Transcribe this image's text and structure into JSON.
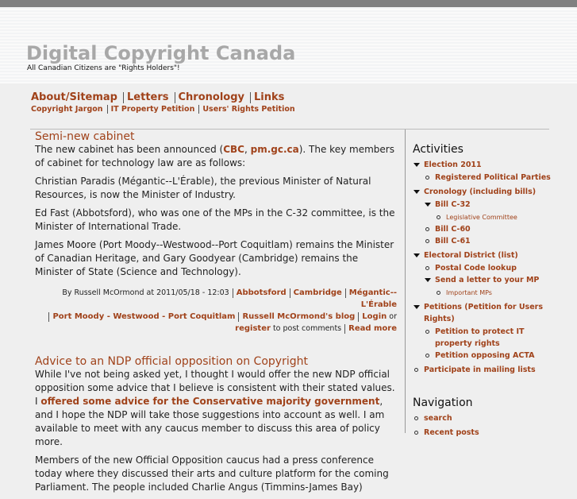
{
  "site": {
    "title": "Digital Copyright Canada",
    "slogan": "All Canadian Citizens are \"Rights Holders\"!"
  },
  "nav": {
    "primary": [
      "About/Sitemap",
      "Letters",
      "Chronology",
      "Links"
    ],
    "secondary": [
      "Copyright Jargon",
      "IT Property Petition",
      "Users' Rights Petition"
    ]
  },
  "posts": [
    {
      "title": "Semi-new cabinet",
      "p1a": "The new cabinet has been announced (",
      "p1l1": "CBC",
      "p1b": ", ",
      "p1l2": "pm.gc.ca",
      "p1c": "). The key members of cabinet for technology law are as follows:",
      "p2": "Christian Paradis (Mégantic--L'Érable), the previous Minister of Natural Resources, is now the Minister of Industry.",
      "p3": "Ed Fast (Abbotsford), who was one of the MPs in the C-32 committee, is the Minister of International Trade.",
      "p4": "James Moore (Port Moody--Westwood--Port Coquitlam) remains the Minister of Canadian Heritage, and Gary Goodyear (Cambridge) remains the Minister of State (Science and Technology).",
      "meta": {
        "byline": "By Russell McOrmond at 2011/05/18 - 12:03",
        "tags": [
          "Abbotsford",
          "Cambridge",
          "Mégantic--L'Érable",
          "Port Moody - Westwood - Port Coquitlam"
        ],
        "blog": "Russell McOrmond's blog",
        "login": "Login",
        "or": " or ",
        "register": "register",
        "post_comments": " to post comments",
        "read_more": "Read more"
      }
    },
    {
      "title": "Advice to an NDP official opposition on Copyright",
      "p1a": "While I've not being asked yet, I thought I would offer the new NDP official opposition some advice that I believe is consistent with their stated values. I ",
      "p1l": "offered some advice for the Conservative majority government",
      "p1b": ", and I hope the NDP will take those suggestions into account as well. I am available to meet with any caucus member to discuss this area of policy more.",
      "p2": "Members of the new Official Opposition caucus had a press conference today where they discussed their arts and culture platform for the coming Parliament. The people included Charlie Angus (Timmins-James Bay)"
    }
  ],
  "sidebar": {
    "activities_title": "Activities",
    "election": "Election 2011",
    "parties": "Registered Political Parties",
    "chronology": "Cronology (including bills)",
    "c32": "Bill C-32",
    "committee": "Legislative Committee",
    "c60": "Bill C-60",
    "c61": "Bill C-61",
    "district": "Electoral District (list)",
    "postal": "Postal Code lookup",
    "letter": "Send a letter to your MP",
    "important": "Important MPs",
    "petitions": "Petitions (Petition for Users Rights)",
    "pet_it": "Petition to protect IT property rights",
    "pet_acta": "Petition opposing ACTA",
    "mailing": "Participate in mailing lists",
    "navigation_title": "Navigation",
    "search": "search",
    "recent": "Recent posts"
  }
}
